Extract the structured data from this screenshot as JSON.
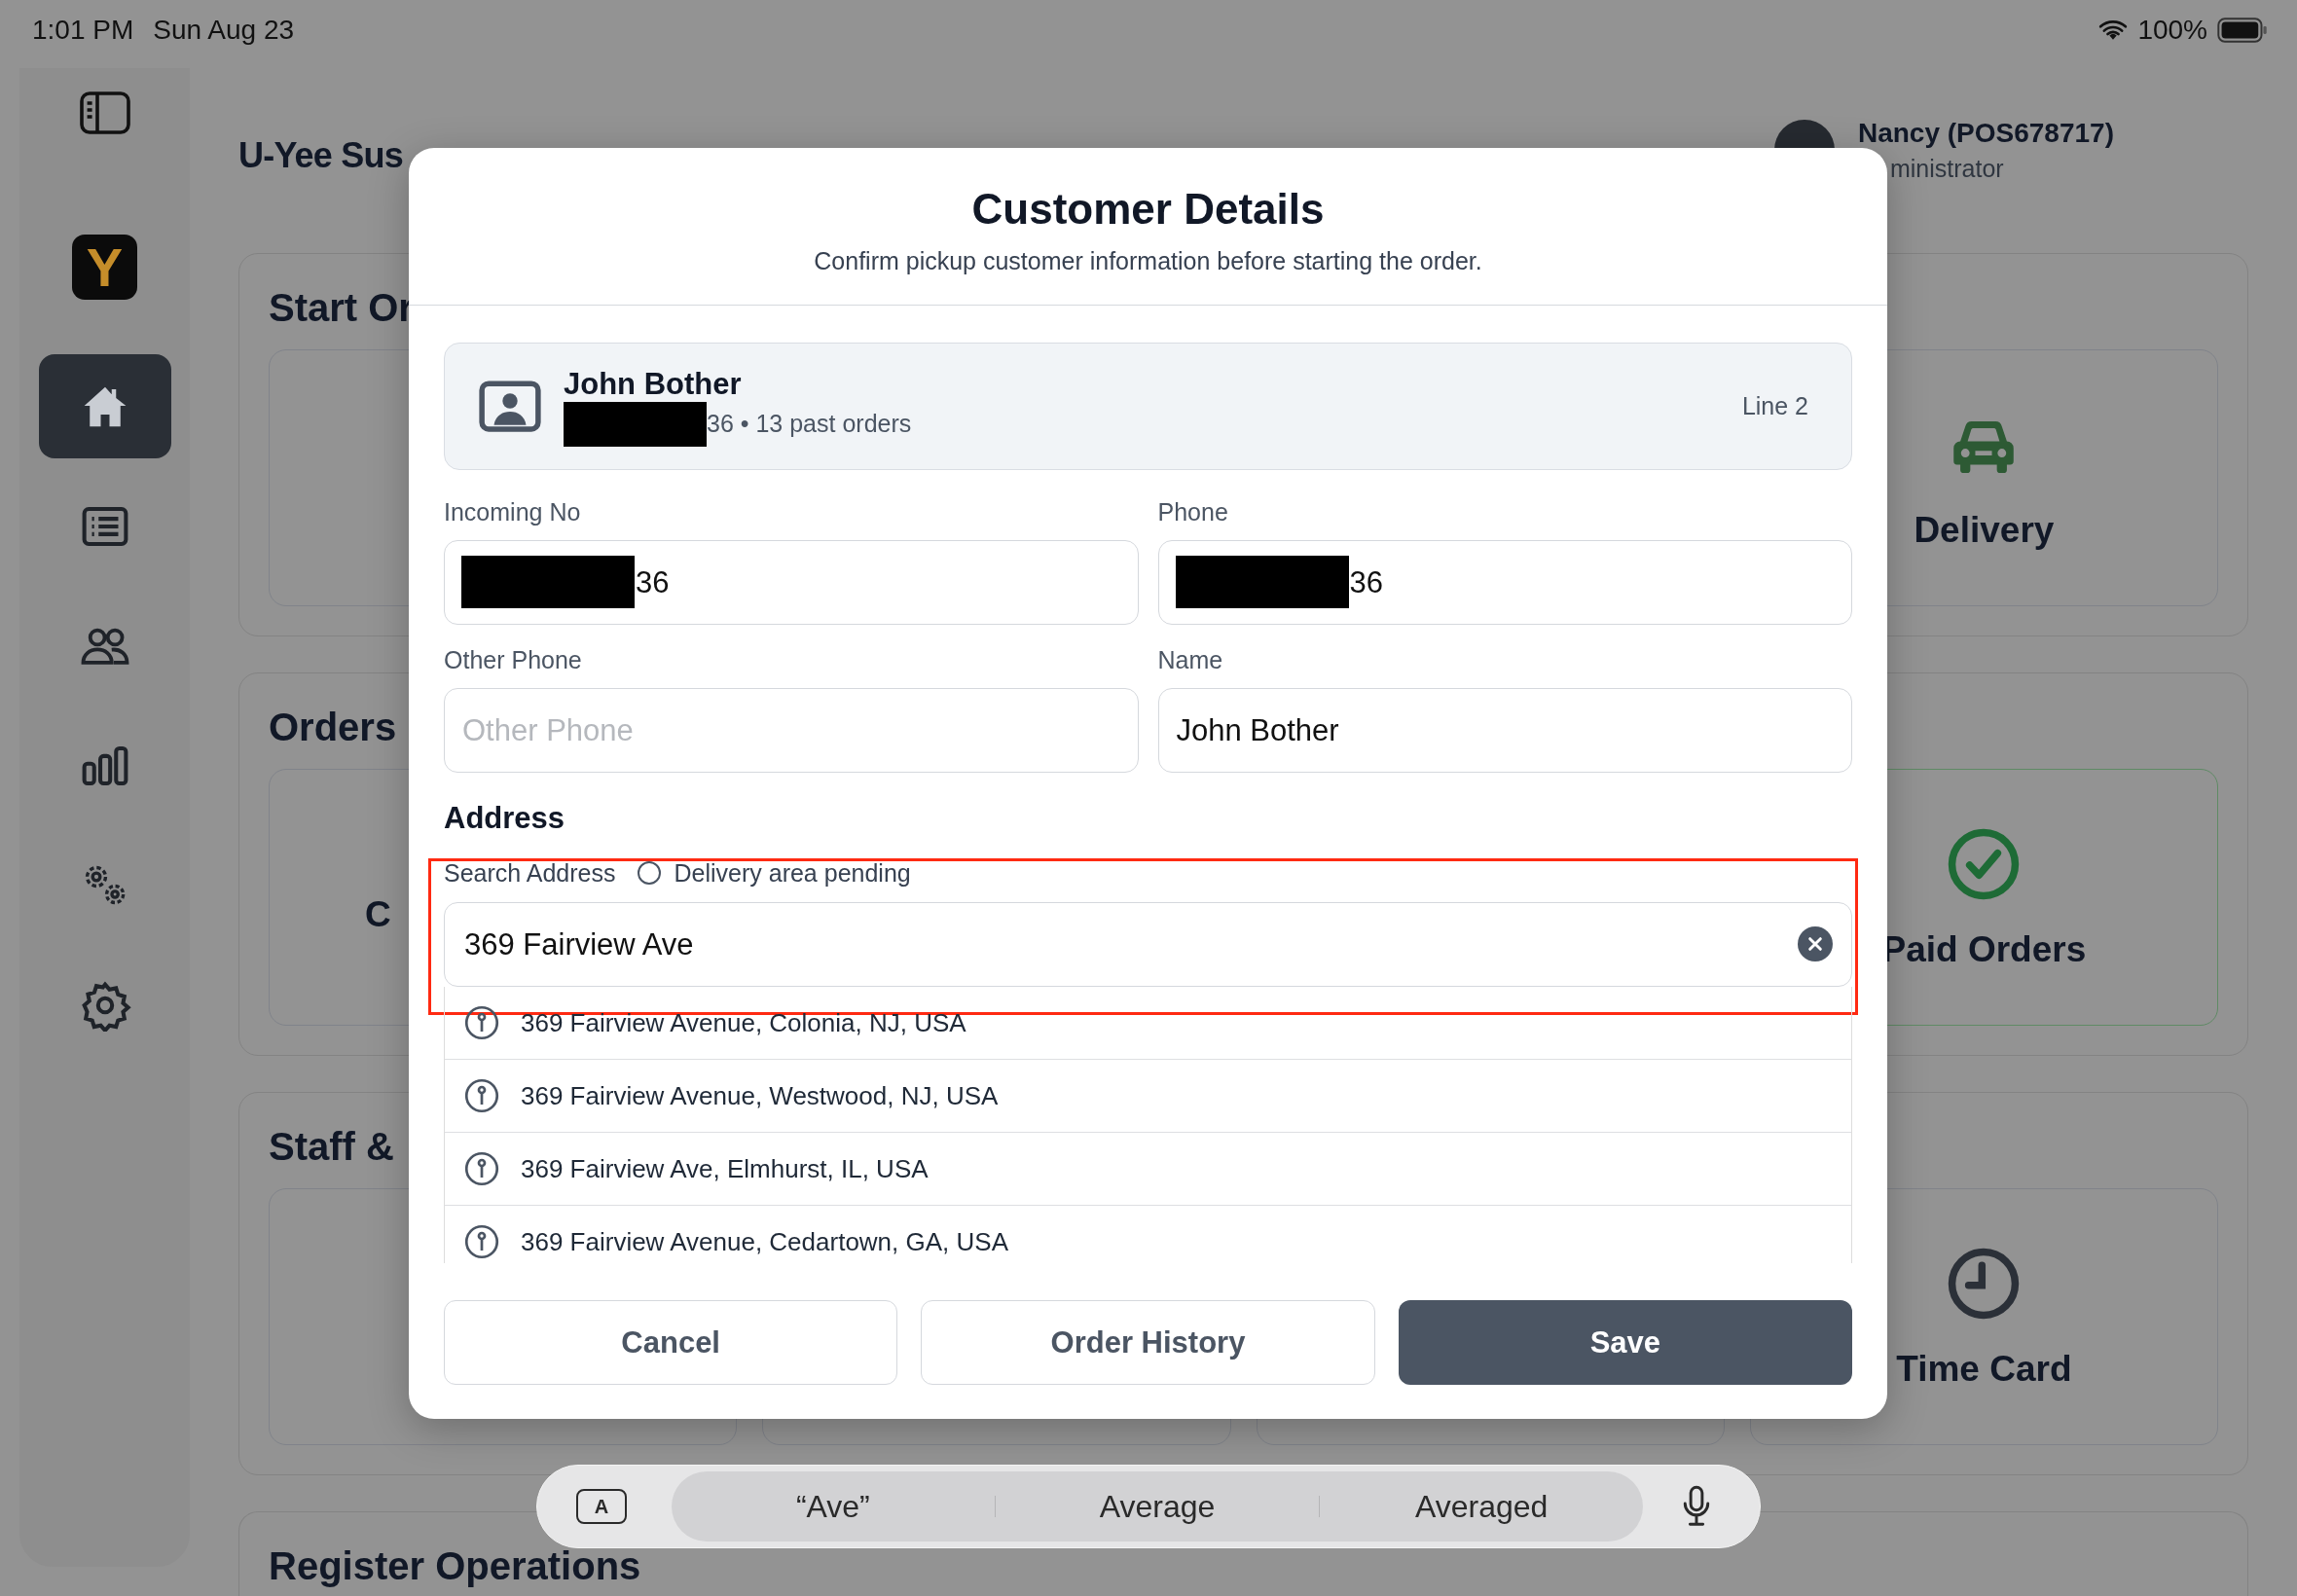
{
  "status_bar": {
    "time": "1:01 PM",
    "date": "Sun Aug 23",
    "battery": "100%"
  },
  "sidebar": {
    "logo": "Y",
    "items": [
      {
        "kind": "home",
        "selected": true
      },
      {
        "kind": "list",
        "selected": false
      },
      {
        "kind": "people",
        "selected": false
      },
      {
        "kind": "chart",
        "selected": false
      },
      {
        "kind": "gears",
        "selected": false
      },
      {
        "kind": "gear",
        "selected": false
      }
    ]
  },
  "header": {
    "title": "U-Yee Sus",
    "user_name": "Nancy (POS678717)",
    "user_role": "ministrator"
  },
  "sections": [
    {
      "title": "Start Or",
      "tiles": [
        {
          "kind": "blank"
        },
        {
          "kind": "blank"
        },
        {
          "kind": "blank"
        },
        {
          "kind": "car",
          "label": "Delivery"
        }
      ]
    },
    {
      "title": "Orders",
      "tiles": [
        {
          "kind": "text",
          "label": "C"
        },
        {
          "kind": "blank"
        },
        {
          "kind": "blank"
        },
        {
          "kind": "check",
          "label": "Paid Orders"
        }
      ]
    },
    {
      "title": "Staff &",
      "tiles": [
        {
          "kind": "blank"
        },
        {
          "kind": "blank"
        },
        {
          "kind": "blank"
        },
        {
          "kind": "clock",
          "label": "Time Card"
        }
      ]
    },
    {
      "title": "Register Operations"
    }
  ],
  "modal": {
    "title": "Customer Details",
    "subtitle": "Confirm pickup customer information before starting the order.",
    "customer": {
      "name": "John Bother",
      "redacted": true,
      "summary": "36 • 13 past orders",
      "line": "Line 2"
    },
    "fields": [
      {
        "label": "Incoming No",
        "value": "36",
        "redacted": true
      },
      {
        "label": "Phone",
        "value": "36",
        "redacted": true
      },
      {
        "label": "Other Phone",
        "placeholder": "Other Phone"
      },
      {
        "label": "Name",
        "value": "John Bother"
      }
    ],
    "address": {
      "heading": "Address",
      "search_label": "Search Address",
      "highlighted": true,
      "area_status": {
        "label": "Delivery area pending",
        "checked": false
      },
      "query": "369 Fairview Ave",
      "suggestions": [
        "369 Fairview Avenue, Colonia, NJ, USA",
        "369 Fairview Avenue, Westwood, NJ, USA",
        "369 Fairview Ave, Elmhurst, IL, USA",
        "369 Fairview Avenue, Cedartown, GA, USA"
      ]
    },
    "buttons": [
      {
        "label": "Cancel",
        "kind": "secondary"
      },
      {
        "label": "Order History",
        "kind": "secondary"
      },
      {
        "label": "Save",
        "kind": "primary"
      }
    ]
  },
  "keyboard_bar": {
    "key_label": "A",
    "suggestions": [
      "“Ave”",
      "Average",
      "Averaged"
    ]
  }
}
